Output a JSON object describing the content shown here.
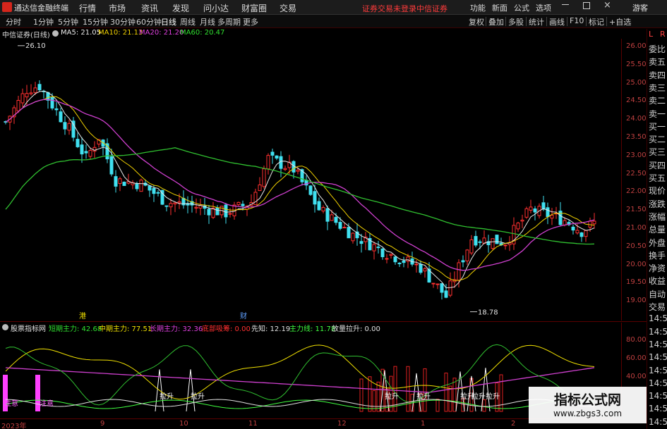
{
  "app": {
    "title": "通达信金融终端",
    "menus": [
      "行情",
      "市场",
      "资讯",
      "发现",
      "问小达",
      "财富圈",
      "交易"
    ],
    "warning": "证券交易未登录",
    "broker": "中信证券",
    "right_buttons": [
      "功能",
      "新面",
      "公式",
      "选项"
    ],
    "guest": "游客"
  },
  "toolbar": {
    "periods": [
      "分时",
      "1分钟",
      "5分钟",
      "15分钟",
      "30分钟",
      "60分钟",
      "日线",
      "周线",
      "月线",
      "多周期",
      "更多"
    ],
    "active_period": "日线",
    "tools": [
      "复权",
      "叠加",
      "多股",
      "统计",
      "画线",
      "F10",
      "标记",
      "+自选"
    ]
  },
  "stock": {
    "name": "中信证券(日线)",
    "ma": [
      {
        "label": "MA5: 21.05",
        "color": "#e8e8e8"
      },
      {
        "label": "MA10: 21.13",
        "color": "#f0d000"
      },
      {
        "label": "MA20: 21.20",
        "color": "#e040e0"
      },
      {
        "label": "MA60: 20.47",
        "color": "#30e030"
      }
    ],
    "high_label": "26.10",
    "low_label": "18.78",
    "tag_left": "港",
    "tag_mid": "财"
  },
  "y_axis": [
    "26.00",
    "25.50",
    "25.00",
    "24.50",
    "24.00",
    "23.50",
    "23.00",
    "22.50",
    "22.00",
    "21.50",
    "21.00",
    "20.50",
    "20.00",
    "19.50",
    "19.00"
  ],
  "right_panel": [
    "委比",
    "卖五",
    "卖四",
    "卖三",
    "卖二",
    "卖一",
    "买一",
    "买二",
    "买三",
    "买四",
    "买五",
    "现价",
    "涨跌",
    "涨幅",
    "总量",
    "外盘",
    "换手",
    "净资",
    "收益",
    "自动",
    "交易",
    "14:5",
    "14:5",
    "14:5",
    "14:5",
    "14:5",
    "14:5",
    "14:5",
    "14:5",
    "14:5"
  ],
  "right_panel_top": "L",
  "right_panel_top2": "R",
  "indicator": {
    "name": "股票指标网",
    "items": [
      {
        "label": "短期主力: 42.68",
        "color": "#30e030"
      },
      {
        "label": "中期主力: 77.51",
        "color": "#f0e000"
      },
      {
        "label": "长期主力: 32.36",
        "color": "#e040e0"
      },
      {
        "label": "底部吸筹: 0.00",
        "color": "#ff3030"
      },
      {
        "label": "先知: 12.19",
        "color": "#e0e0e0"
      },
      {
        "label": "主力线: 11.78",
        "color": "#40ff40"
      },
      {
        "label": "放量拉升: 0.00",
        "color": "#e0e0e0"
      }
    ],
    "y_axis": [
      "80.00",
      "60.00",
      "40.00"
    ],
    "annotations": [
      "注意",
      "注意",
      "拉升",
      "拉升",
      "拉升",
      "拉升",
      "拉升",
      "拉升",
      "拉升"
    ]
  },
  "x_axis": [
    "2023年",
    "9",
    "10",
    "11",
    "12",
    "1",
    "2"
  ],
  "watermark": {
    "title": "指标公式网",
    "url": "www.zbgs3.com"
  }
}
